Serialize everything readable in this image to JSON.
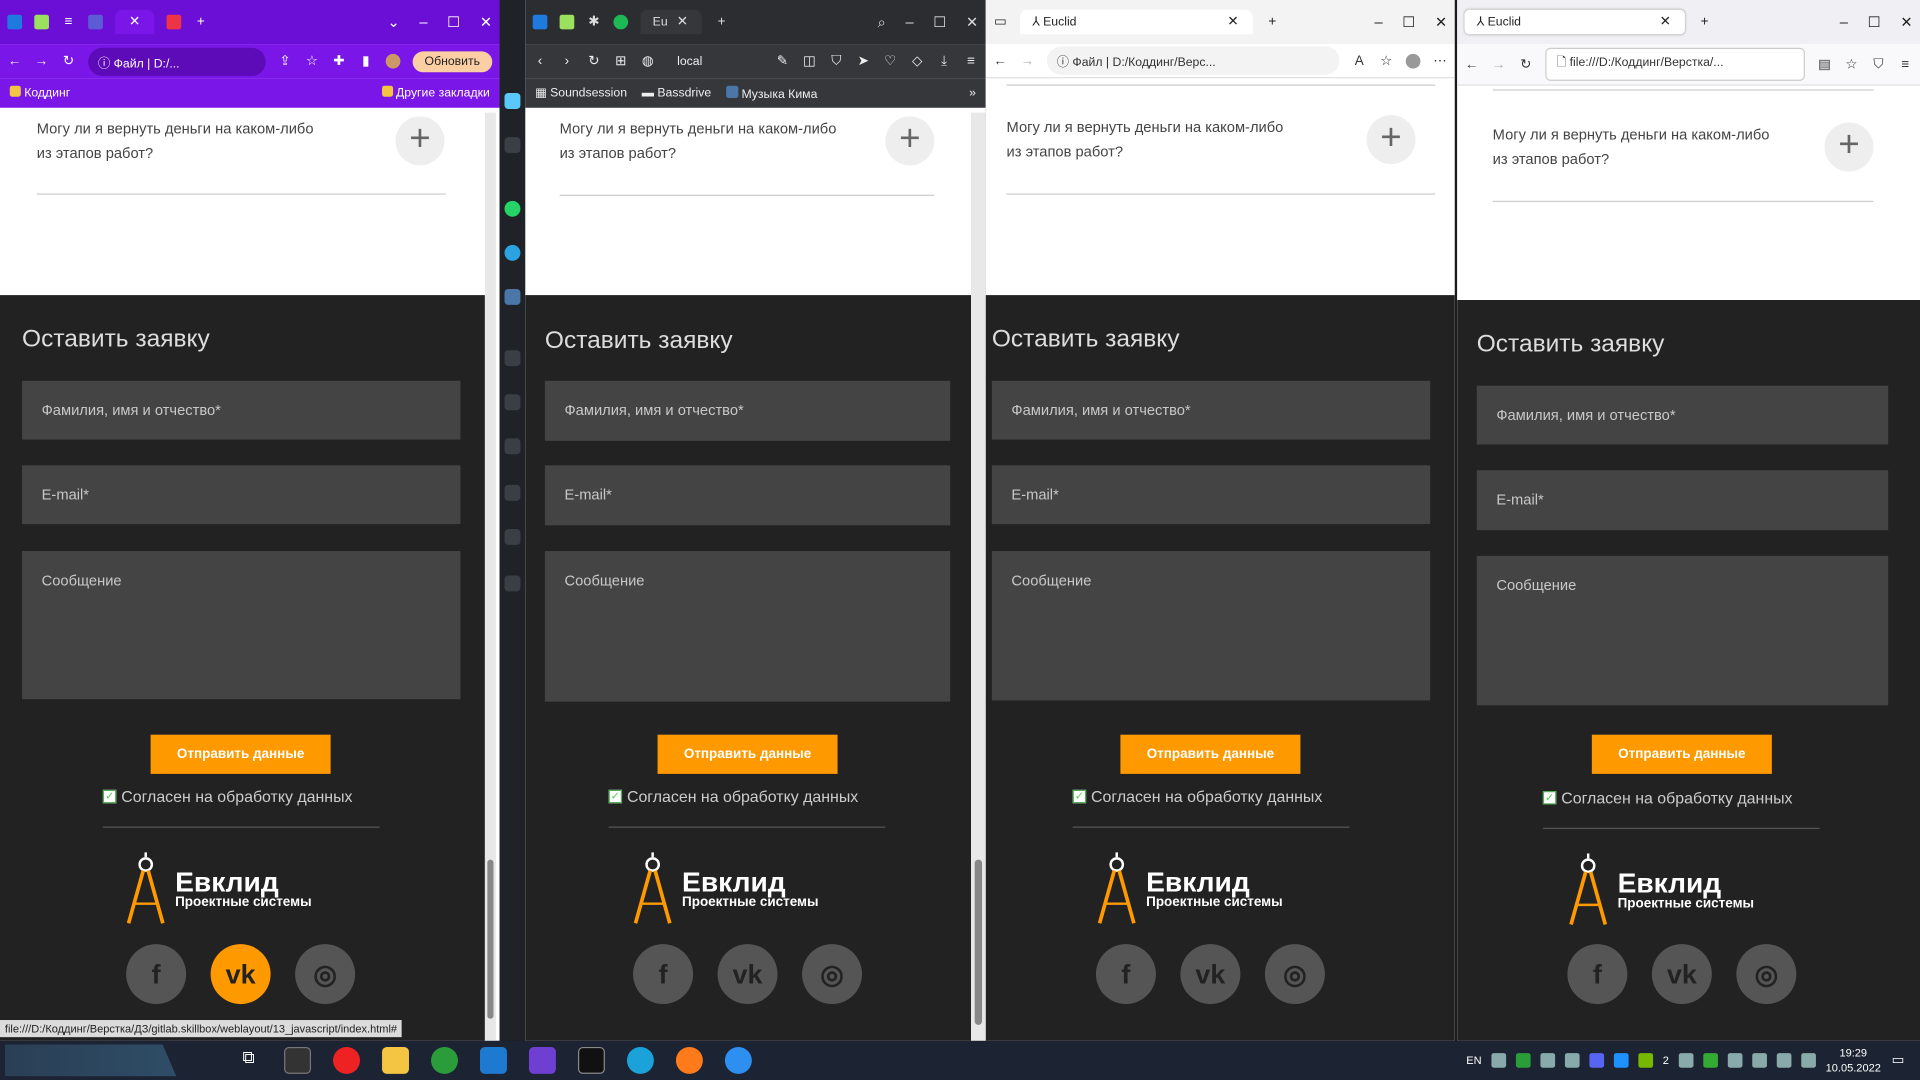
{
  "windows": [
    {
      "browser": "chrome",
      "tabs": [],
      "address": {
        "scheme": "Файл",
        "url": "D:/..."
      },
      "update_label": "Обновить",
      "bookmarks": {
        "left": "Коддинг",
        "right": "Другие закладки"
      },
      "status_url": "file:///D:/Коддинг/Верстка/ДЗ/gitlab.skillbox/weblayout/13_javascript/index.html#"
    },
    {
      "browser": "opera",
      "tabs": [
        {
          "label": "Eu"
        }
      ],
      "address": {
        "url": "local"
      },
      "bookmarks": [
        "Soundsession",
        "Bassdrive",
        "Музыка Кима"
      ]
    },
    {
      "browser": "edge",
      "tabs": [
        {
          "label": "Euclid"
        }
      ],
      "address": {
        "scheme": "Файл",
        "url": "D:/Коддинг/Верс..."
      }
    },
    {
      "browser": "firefox",
      "tabs": [
        {
          "label": "Euclid"
        }
      ],
      "address": {
        "url": "file:///D:/Коддинг/Верстка/..."
      }
    }
  ],
  "site": {
    "faq_question": "Могу ли я вернуть деньги на каком-либо из этапов работ?",
    "faq_line1": "Могу ли я вернуть деньги на каком-либо",
    "faq_line2": "из этапов работ?",
    "form_title": "Оставить заявку",
    "name_placeholder": "Фамилия, имя и отчество*",
    "email_placeholder": "E-mail*",
    "message_placeholder": "Сообщение",
    "submit_label": "Отправить данные",
    "consent_label": "Согласен на обработку данных",
    "consent_checked": true,
    "logo_title": "Евклид",
    "logo_subtitle": "Проектные системы",
    "socials": [
      "facebook",
      "vk",
      "instagram"
    ],
    "accent_color": "#ff9900"
  },
  "taskbar": {
    "lang": "EN",
    "time": "19:29",
    "date": "10.05.2022",
    "tray_badge": "2"
  }
}
